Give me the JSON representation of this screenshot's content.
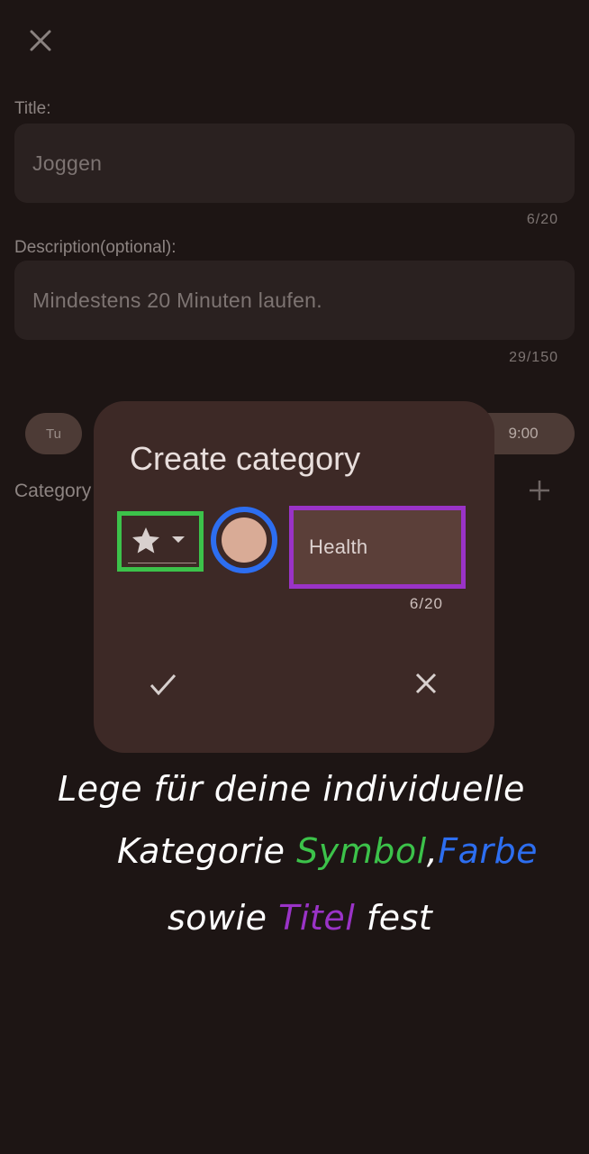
{
  "form": {
    "title_label": "Title:",
    "title_value": "Joggen",
    "title_counter": "6/20",
    "description_label": "Description(optional):",
    "description_value": "Mindestens 20 Minuten laufen.",
    "description_counter": "29/150",
    "day_chip": "Tu",
    "time_chip": "9:00",
    "category_label": "Category"
  },
  "dialog": {
    "title": "Create category",
    "category_name": "Health",
    "name_counter": "6/20",
    "selected_color": "#d9ab96"
  },
  "annotation": {
    "line1": "Lege für deine individuelle",
    "line2_a": "Kategorie ",
    "line2_symbol": "Symbol",
    "line2_comma": ",",
    "line2_farbe": "Farbe",
    "line3_a": "sowie ",
    "line3_titel": "Titel",
    "line3_b": " fest",
    "colors": {
      "symbol": "#3cc24a",
      "farbe": "#2d6ef0",
      "titel": "#9a33c7"
    }
  }
}
